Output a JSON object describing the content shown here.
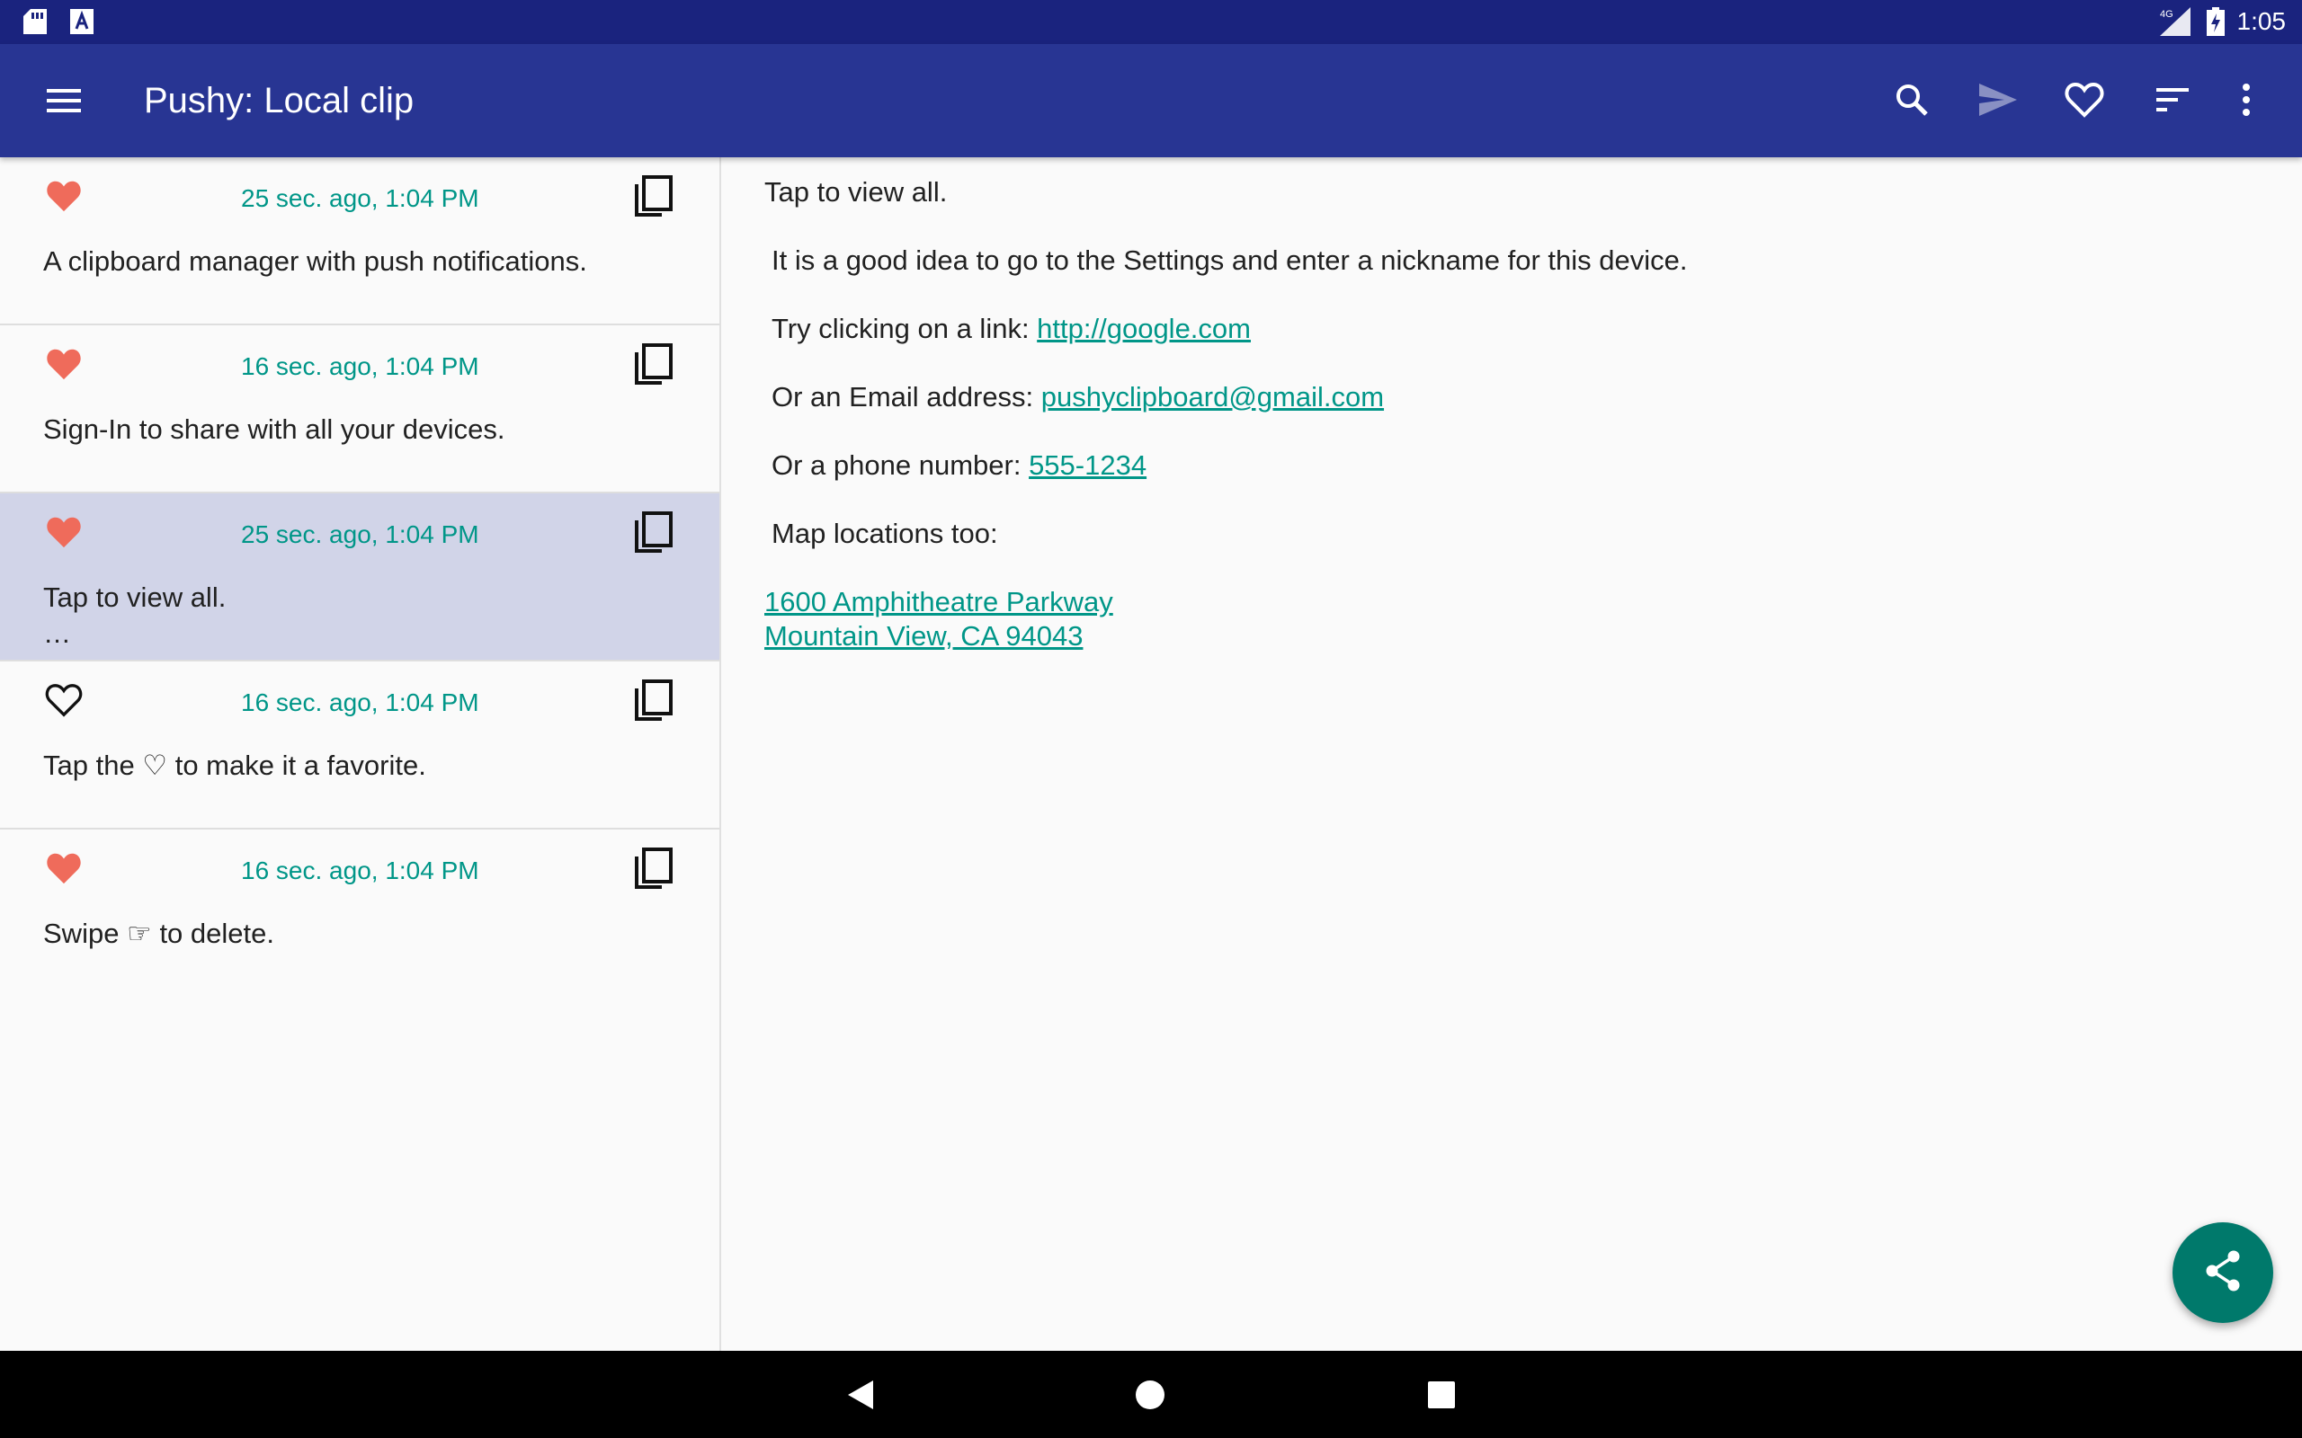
{
  "status_bar": {
    "time": "1:05",
    "network": "4G",
    "icons": [
      "sd-card-icon",
      "text-a-icon",
      "signal-icon",
      "battery-charging-icon"
    ]
  },
  "app_bar": {
    "title": "Pushy: Local clip",
    "actions": [
      "search-icon",
      "send-icon",
      "heart-outline-icon",
      "sort-icon",
      "more-vert-icon"
    ]
  },
  "clips": [
    {
      "favorite": true,
      "time": "25 sec. ago, 1:04 PM",
      "text": "A clipboard manager with push notifications.",
      "selected": false
    },
    {
      "favorite": true,
      "time": "16 sec. ago, 1:04 PM",
      "text": "Sign-In to share with all your devices.",
      "selected": false
    },
    {
      "favorite": true,
      "time": "25 sec. ago, 1:04 PM",
      "text": "Tap to view all.\n…",
      "selected": true
    },
    {
      "favorite": false,
      "time": "16 sec. ago, 1:04 PM",
      "text": "Tap the ♡ to make it a favorite.",
      "selected": false
    },
    {
      "favorite": true,
      "time": "16 sec. ago, 1:04 PM",
      "text": "Swipe ☞ to delete.",
      "selected": false
    }
  ],
  "detail": {
    "heading": "Tap to view all.",
    "nickname_tip": "It is a good idea to go to the Settings and enter a nickname for this device.",
    "link_prefix": "Try clicking on a link: ",
    "link": "http://google.com",
    "email_prefix": "Or an Email address: ",
    "email": "pushyclipboard@gmail.com",
    "phone_prefix": "Or a phone number: ",
    "phone": "555-1234",
    "map_prefix": "Map locations too:",
    "address_line1": "1600 Amphitheatre Parkway",
    "address_line2": "Mountain View, CA 94043"
  },
  "colors": {
    "status_bar": "#1a237e",
    "app_bar": "#283593",
    "accent": "#009688",
    "favorite": "#ef6b5b",
    "fab": "#00796b",
    "selected_row": "#d1d4e8"
  }
}
